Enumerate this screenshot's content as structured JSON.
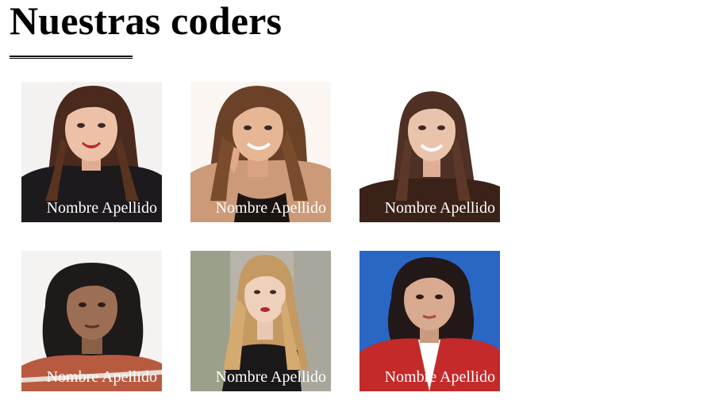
{
  "page": {
    "title": "Nuestras coders"
  },
  "coders": [
    {
      "name": "Nombre Apellido",
      "photo_icon": "portrait-photo-woman-dark-wavy-hair"
    },
    {
      "name": "Nombre Apellido",
      "photo_icon": "portrait-photo-woman-hand-on-cheek"
    },
    {
      "name": "Nombre Apellido",
      "photo_icon": "portrait-photo-woman-long-straight-hair"
    },
    {
      "name": "Nombre Apellido",
      "photo_icon": "portrait-photo-woman-curly-hair"
    },
    {
      "name": "Nombre Apellido",
      "photo_icon": "portrait-photo-woman-blonde-waves"
    },
    {
      "name": "Nombre Apellido",
      "photo_icon": "portrait-photo-woman-blue-background"
    }
  ],
  "colors": {
    "text": "#000000",
    "caption": "#ffffff",
    "background": "#ffffff"
  }
}
